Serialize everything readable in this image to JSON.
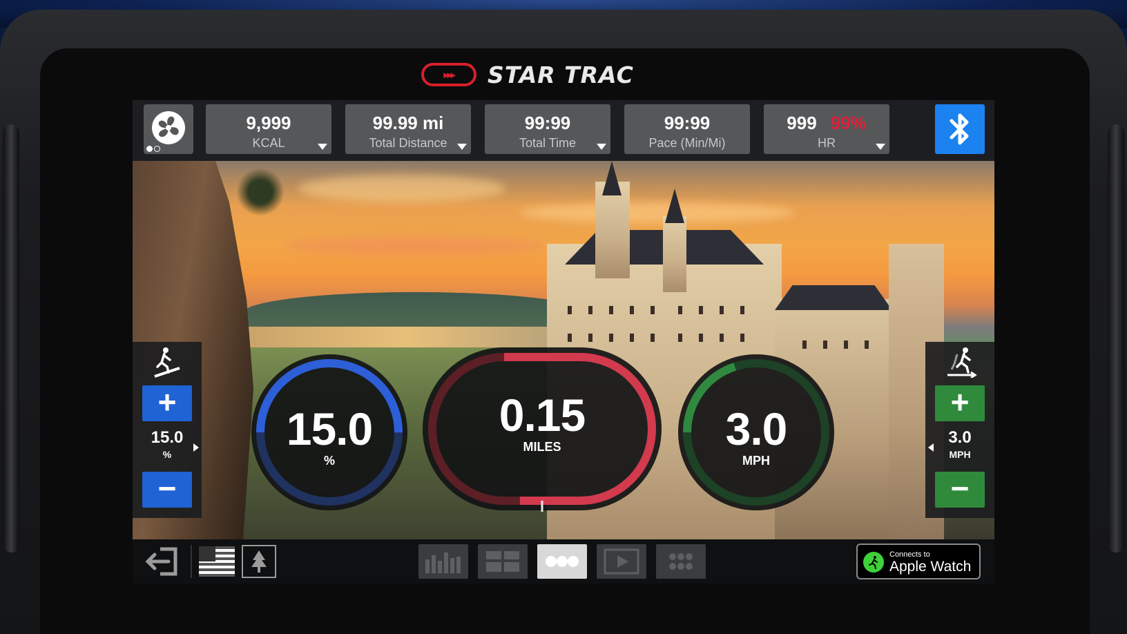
{
  "brand": {
    "name": "STAR TRAC",
    "mark": "▸▸▸"
  },
  "fan": {
    "icon": "fan-icon"
  },
  "stats": [
    {
      "value": "9,999",
      "label": "KCAL",
      "has_dropdown": true
    },
    {
      "value": "99.99 mi",
      "label": "Total Distance",
      "has_dropdown": true
    },
    {
      "value": "99:99",
      "label": "Total Time",
      "has_dropdown": true
    },
    {
      "value": "99:99",
      "label": "Pace (Min/Mi)",
      "has_dropdown": false
    },
    {
      "value": "999",
      "extra": "99%",
      "label": "HR",
      "has_dropdown": true
    }
  ],
  "bluetooth": {
    "icon": "bluetooth-icon",
    "color": "#1c82f0"
  },
  "incline": {
    "icon": "incline-runner-icon",
    "plus": "+",
    "minus": "−",
    "value": "15.0",
    "unit": "%",
    "color": "#1f63d4"
  },
  "speed": {
    "icon": "speed-runner-icon",
    "plus": "+",
    "minus": "−",
    "value": "3.0",
    "unit": "MPH",
    "color": "#2f8b3b"
  },
  "gauges": {
    "incline": {
      "value": "15.0",
      "unit": "%",
      "fraction": 0.5,
      "color": "#2c5fd8"
    },
    "distance": {
      "value": "0.15",
      "unit": "MILES",
      "fraction": 0.6,
      "color": "#d23a4e"
    },
    "speed": {
      "value": "3.0",
      "unit": "MPH",
      "fraction": 0.2,
      "color": "#2f8a40"
    }
  },
  "bottom": {
    "exit": "exit-icon",
    "flag": "us-flag-icon",
    "scene": "tree-icon",
    "modes": [
      {
        "name": "bar-chart-mode",
        "active": false
      },
      {
        "name": "split-mode",
        "active": false
      },
      {
        "name": "dots-mode",
        "active": true
      },
      {
        "name": "video-mode",
        "active": false
      },
      {
        "name": "apps-mode",
        "active": false
      }
    ],
    "apple_watch": {
      "small": "Connects to",
      "large": "Apple Watch"
    }
  }
}
